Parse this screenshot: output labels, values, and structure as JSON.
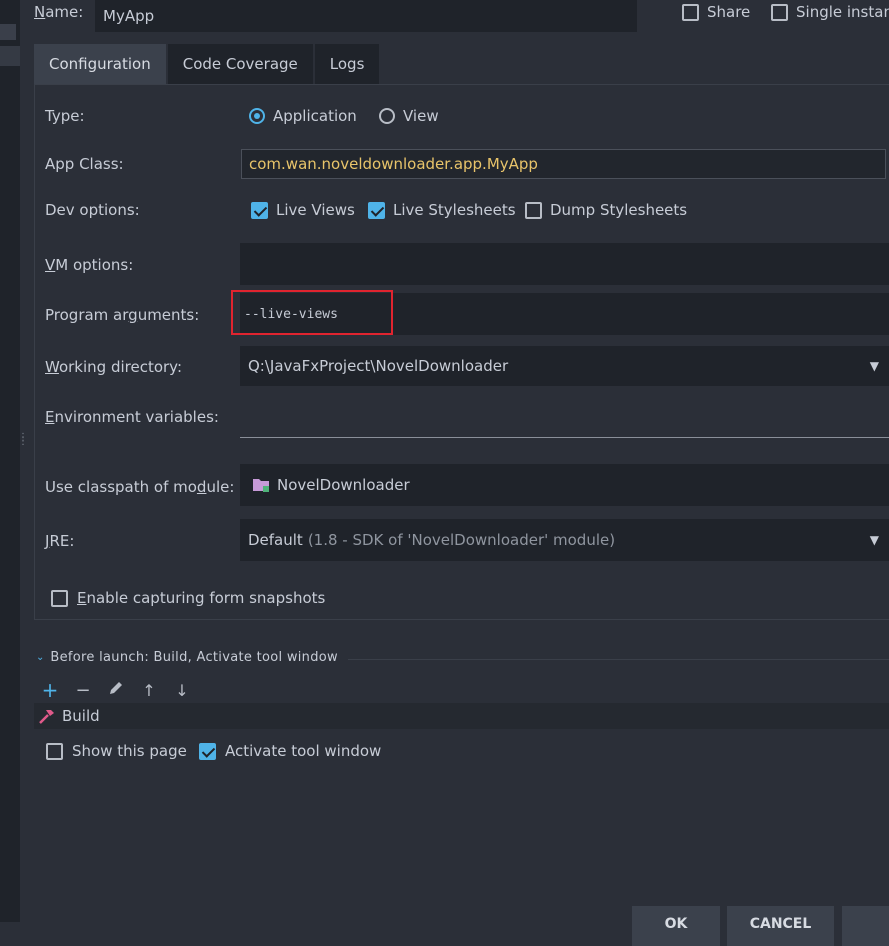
{
  "header": {
    "name_label": "Name:",
    "name_value": "MyApp",
    "share_label": "Share",
    "single_instance_label": "Single instan"
  },
  "tabs": [
    {
      "label": "Configuration"
    },
    {
      "label": "Code Coverage"
    },
    {
      "label": "Logs"
    }
  ],
  "form": {
    "type_label": "Type:",
    "type_options": [
      {
        "label": "Application",
        "selected": true
      },
      {
        "label": "View",
        "selected": false
      }
    ],
    "app_class_label": "App Class:",
    "app_class_value": "com.wan.noveldownloader.app.MyApp",
    "dev_options_label": "Dev options:",
    "dev_options": [
      {
        "label": "Live Views",
        "checked": true
      },
      {
        "label": "Live Stylesheets",
        "checked": true
      },
      {
        "label": "Dump Stylesheets",
        "checked": false
      }
    ],
    "vm_options_label": "VM options:",
    "vm_options_value": "",
    "program_args_label": "Program arguments:",
    "program_args_value": "--live-views",
    "working_dir_label": "Working directory:",
    "working_dir_value": "Q:\\JavaFxProject\\NovelDownloader",
    "env_vars_label": "Environment variables:",
    "env_vars_value": "",
    "classpath_label": "Use classpath of module:",
    "classpath_value": "NovelDownloader",
    "jre_label": "JRE:",
    "jre_value_main": "Default",
    "jre_value_detail": "(1.8 - SDK of 'NovelDownloader' module)",
    "snapshots_label": "Enable capturing form snapshots"
  },
  "before_launch": {
    "title": "Before launch: Build, Activate tool window",
    "task": "Build",
    "show_page_label": "Show this page",
    "activate_label": "Activate tool window"
  },
  "buttons": {
    "ok": "OK",
    "cancel": "CANCEL"
  },
  "colors": {
    "accent": "#4fb3e8",
    "background": "#2b2f38",
    "field": "#1f232a",
    "highlight_box": "#e0242f",
    "class_text": "#e8c46a"
  }
}
